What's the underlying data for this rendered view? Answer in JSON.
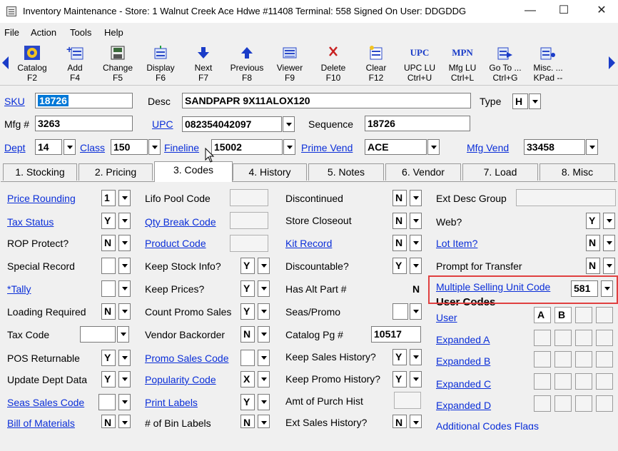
{
  "window": {
    "title": "Inventory Maintenance  -  Store: 1   Walnut Creek Ace Hdwe #11408   Terminal: 558   Signed On User: DDGDDG",
    "minimize": "—",
    "maximize": "☐",
    "close": "✕"
  },
  "menu": [
    "File",
    "Action",
    "Tools",
    "Help"
  ],
  "toolbar": [
    {
      "label": "Catalog",
      "key": "F2",
      "icon": "catalog-icon"
    },
    {
      "label": "Add",
      "key": "F4",
      "icon": "add-icon"
    },
    {
      "label": "Change",
      "key": "F5",
      "icon": "change-icon"
    },
    {
      "label": "Display",
      "key": "F6",
      "icon": "display-icon"
    },
    {
      "label": "Next",
      "key": "F7",
      "icon": "arrow-down-icon"
    },
    {
      "label": "Previous",
      "key": "F8",
      "icon": "arrow-up-icon"
    },
    {
      "label": "Viewer",
      "key": "F9",
      "icon": "viewer-icon"
    },
    {
      "label": "Delete",
      "key": "F10",
      "icon": "delete-icon"
    },
    {
      "label": "Clear",
      "key": "F12",
      "icon": "clear-icon"
    },
    {
      "label": "UPC LU",
      "key": "Ctrl+U",
      "icon_text": "UPC"
    },
    {
      "label": "Mfg LU",
      "key": "Ctrl+L",
      "icon_text": "MPN"
    },
    {
      "label": "Go To ...",
      "key": "Ctrl+G",
      "icon": "goto-icon"
    },
    {
      "label": "Misc. ...",
      "key": "KPad --",
      "icon": "misc-icon"
    }
  ],
  "header": {
    "sku_label": "SKU",
    "sku": "18726",
    "desc_label": "Desc",
    "desc": "SANDPAPR 9X11ALOX120",
    "type_label": "Type",
    "type": "H",
    "mfg_label": "Mfg #",
    "mfg": "3263",
    "upc_label": "UPC",
    "upc": "082354042097",
    "sequence_label": "Sequence",
    "sequence": "18726",
    "dept_label": "Dept",
    "dept": "14",
    "class_label": "Class",
    "class": "150",
    "fineline_label": "Fineline",
    "fineline": "15002",
    "prime_vend_label": "Prime Vend",
    "prime_vend": "ACE",
    "mfg_vend_label": "Mfg Vend",
    "mfg_vend": "33458"
  },
  "tabs": [
    "1. Stocking",
    "2. Pricing",
    "3. Codes",
    "4. History",
    "5. Notes",
    "6. Vendor",
    "7. Load",
    "8. Misc"
  ],
  "codes": {
    "col1": [
      {
        "label": "Price Rounding",
        "value": "1"
      },
      {
        "label": "Tax Status",
        "value": "Y"
      },
      {
        "label": "ROP Protect?",
        "value": "N"
      },
      {
        "label": "Special Record",
        "value": ""
      },
      {
        "label": "*Tally",
        "value": ""
      },
      {
        "label": "Loading Required",
        "value": "N"
      },
      {
        "label": "Tax Code",
        "value": ""
      },
      {
        "label": "POS Returnable",
        "value": "Y"
      },
      {
        "label": "Update Dept Data",
        "value": "Y"
      },
      {
        "label": "Seas Sales Code",
        "value": ""
      },
      {
        "label": "Bill of Materials",
        "value": "N"
      }
    ],
    "col2": [
      {
        "label": "Lifo Pool Code",
        "value": ""
      },
      {
        "label": "Qty Break Code",
        "value": ""
      },
      {
        "label": "Product Code",
        "value": ""
      },
      {
        "label": "Keep Stock Info?",
        "value": "Y"
      },
      {
        "label": "Keep Prices?",
        "value": "Y"
      },
      {
        "label": "Count Promo Sales",
        "value": "Y"
      },
      {
        "label": "Vendor Backorder",
        "value": "N"
      },
      {
        "label": "Promo Sales Code",
        "value": ""
      },
      {
        "label": "Popularity Code",
        "value": "X"
      },
      {
        "label": "Print Labels",
        "value": "Y"
      },
      {
        "label": "# of Bin Labels",
        "value": "N"
      }
    ],
    "col3": [
      {
        "label": "Discontinued",
        "value": "N"
      },
      {
        "label": "Store Closeout",
        "value": "N"
      },
      {
        "label": "Kit Record",
        "value": "N"
      },
      {
        "label": "Discountable?",
        "value": "Y"
      },
      {
        "label": "Has Alt Part #",
        "value": "N"
      },
      {
        "label": "Seas/Promo",
        "value": ""
      },
      {
        "label": "Catalog Pg #",
        "value": "10517"
      },
      {
        "label": "Keep Sales History?",
        "value": "Y"
      },
      {
        "label": "Keep Promo History?",
        "value": "Y"
      },
      {
        "label": "Amt of Purch Hist",
        "value": ""
      },
      {
        "label": "Ext Sales History?",
        "value": "N"
      }
    ],
    "col4": [
      {
        "label": "Ext Desc Group",
        "value": ""
      },
      {
        "label": "Web?",
        "value": "Y"
      },
      {
        "label": "Lot Item?",
        "value": "N"
      },
      {
        "label": "Prompt for Transfer",
        "value": "N"
      },
      {
        "label": "Multiple Selling Unit Code",
        "value": "581"
      }
    ],
    "user_codes_title": "User Codes",
    "user_rows": [
      {
        "label": "User",
        "values": [
          "A",
          "B",
          "",
          ""
        ]
      },
      {
        "label": "Expanded A",
        "values": [
          "",
          "",
          "",
          ""
        ]
      },
      {
        "label": "Expanded B",
        "values": [
          "",
          "",
          "",
          ""
        ]
      },
      {
        "label": "Expanded C",
        "values": [
          "",
          "",
          "",
          ""
        ]
      },
      {
        "label": "Expanded D",
        "values": [
          "",
          "",
          "",
          ""
        ]
      }
    ],
    "additional_flags": "Additional Codes Flags"
  }
}
